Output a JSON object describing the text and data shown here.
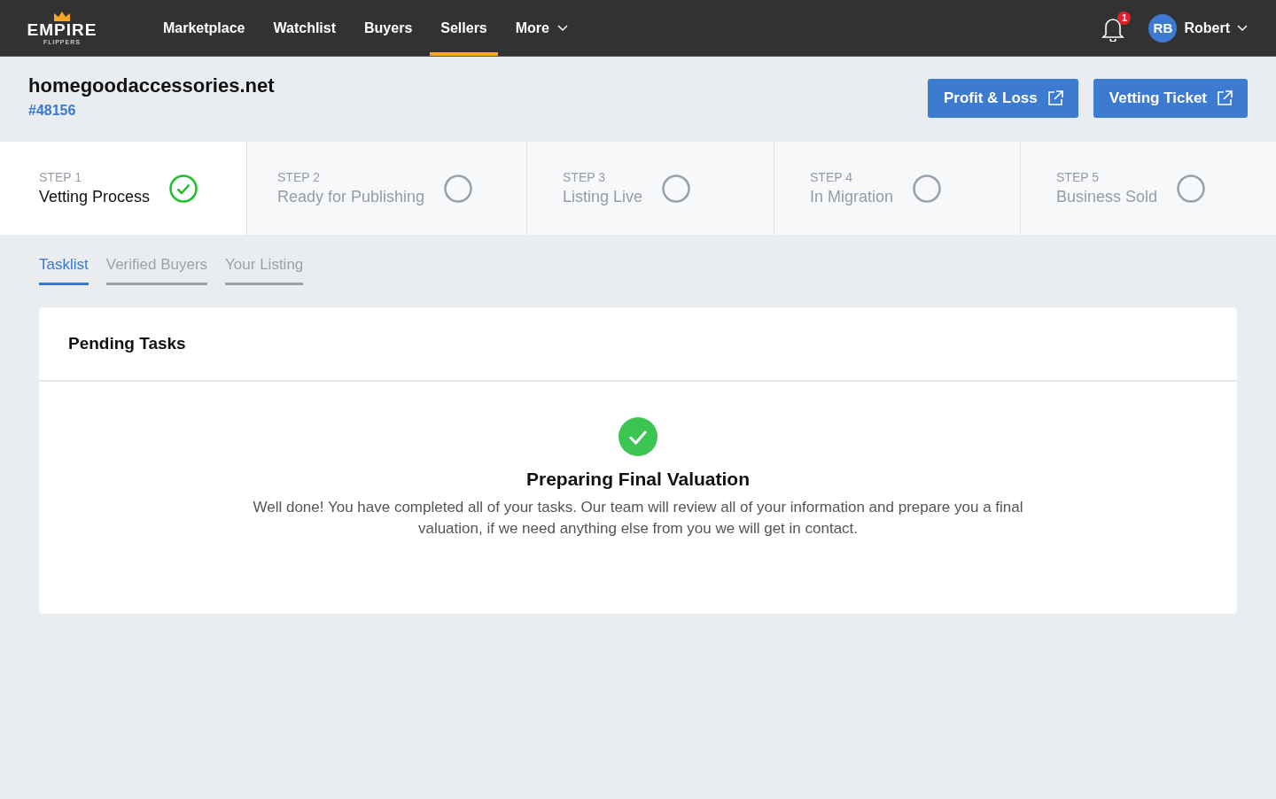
{
  "logo": {
    "word": "EMPIRE",
    "subword": "FLIPPERS"
  },
  "nav": [
    {
      "label": "Marketplace",
      "selected": false,
      "dropdown": false
    },
    {
      "label": "Watchlist",
      "selected": false,
      "dropdown": false
    },
    {
      "label": "Buyers",
      "selected": false,
      "dropdown": false
    },
    {
      "label": "Sellers",
      "selected": true,
      "dropdown": false
    },
    {
      "label": "More",
      "selected": false,
      "dropdown": true
    }
  ],
  "notifications": {
    "count": "1"
  },
  "user": {
    "initials": "RB",
    "name": "Robert"
  },
  "listing": {
    "title": "homegoodaccessories.net",
    "id": "#48156"
  },
  "actions": [
    {
      "label": "Profit & Loss"
    },
    {
      "label": "Vetting Ticket"
    }
  ],
  "steps": [
    {
      "step": "STEP 1",
      "label": "Vetting Process",
      "selected": true,
      "done": true
    },
    {
      "step": "STEP 2",
      "label": "Ready for Publishing",
      "selected": false,
      "done": false
    },
    {
      "step": "STEP 3",
      "label": "Listing Live",
      "selected": false,
      "done": false
    },
    {
      "step": "STEP 4",
      "label": "In Migration",
      "selected": false,
      "done": false
    },
    {
      "step": "STEP 5",
      "label": "Business Sold",
      "selected": false,
      "done": false
    }
  ],
  "tabs": [
    {
      "label": "Tasklist",
      "selected": true
    },
    {
      "label": "Verified Buyers",
      "selected": false
    },
    {
      "label": "Your Listing",
      "selected": false
    }
  ],
  "card": {
    "title": "Pending Tasks",
    "status": {
      "done": true,
      "heading": "Preparing Final Valuation",
      "message": "Well done! You have completed all of your tasks. Our team will review all of your information and prepare you a final valuation, if we need anything else from you we will get in contact."
    }
  }
}
